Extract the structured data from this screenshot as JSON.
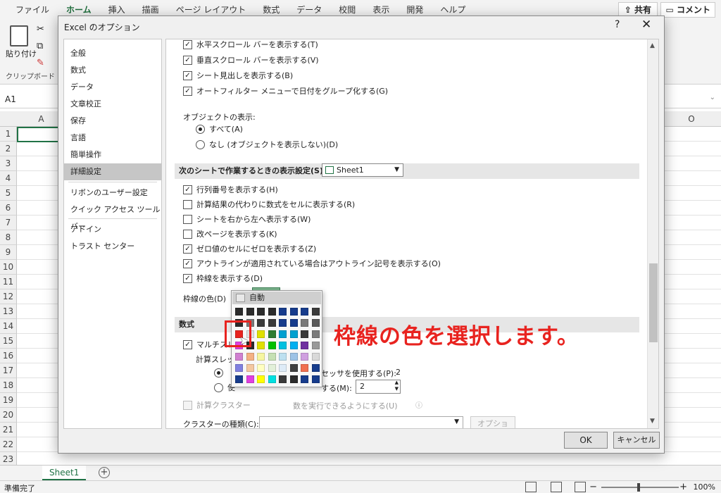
{
  "ribbon": {
    "tabs": [
      "ファイル",
      "ホーム",
      "挿入",
      "描画",
      "ページ レイアウト",
      "数式",
      "データ",
      "校閲",
      "表示",
      "開発",
      "ヘルプ"
    ],
    "active_tab": "ホーム",
    "share_label": "共有",
    "comment_label": "コメント",
    "paste_label": "貼り付け",
    "clipboard_label": "クリップボード"
  },
  "formula_bar": {
    "name_box": "A1"
  },
  "grid": {
    "columns": [
      "A",
      "O"
    ],
    "rows": [
      "1",
      "2",
      "3",
      "4",
      "5",
      "6",
      "7",
      "8",
      "9",
      "10",
      "11",
      "12",
      "13",
      "14",
      "15",
      "16",
      "17",
      "18",
      "19",
      "20",
      "21",
      "22",
      "23"
    ]
  },
  "sheet_tabs": {
    "active": "Sheet1"
  },
  "status": {
    "ready": "準備完了",
    "zoom": "100%"
  },
  "dialog": {
    "title": "Excel のオプション",
    "help": "?",
    "close": "✕",
    "nav": [
      "全般",
      "数式",
      "データ",
      "文章校正",
      "保存",
      "言語",
      "簡単操作",
      "詳細設定",
      "リボンのユーザー設定",
      "クイック アクセス ツール バー",
      "アドイン",
      "トラスト センター"
    ],
    "active_nav": "詳細設定",
    "options_top": [
      {
        "label": "水平スクロール バーを表示する(T)",
        "checked": true
      },
      {
        "label": "垂直スクロール バーを表示する(V)",
        "checked": true
      },
      {
        "label": "シート見出しを表示する(B)",
        "checked": true
      },
      {
        "label": "オートフィルター メニューで日付をグループ化する(G)",
        "checked": true
      }
    ],
    "objects_label": "オブジェクトの表示:",
    "objects_radio": [
      {
        "label": "すべて(A)",
        "selected": true
      },
      {
        "label": "なし (オブジェクトを表示しない)(D)",
        "selected": false
      }
    ],
    "sheet_section_label": "次のシートで作業するときの表示設定(S):",
    "sheet_select": "Sheet1",
    "options_sheet": [
      {
        "label": "行列番号を表示する(H)",
        "checked": true
      },
      {
        "label": "計算結果の代わりに数式をセルに表示する(R)",
        "checked": false
      },
      {
        "label": "シートを右から左へ表示する(W)",
        "checked": false
      },
      {
        "label": "改ページを表示する(K)",
        "checked": false
      },
      {
        "label": "ゼロ値のセルにゼロを表示する(Z)",
        "checked": true
      },
      {
        "label": "アウトラインが適用されている場合はアウトライン記号を表示する(O)",
        "checked": true
      },
      {
        "label": "枠線を表示する(D)",
        "checked": true
      }
    ],
    "gridline_color_label": "枠線の色(D)",
    "formula_section": "数式",
    "multithread_label": "マルチスレ",
    "calc_threads_label": "計算スレッ",
    "radio_all_suffix": "セッサを使用する(P):",
    "radio_all_value": "2",
    "radio_manual_prefix": "使",
    "radio_manual_suffix": "する(M):",
    "manual_value": "2",
    "cluster_option_prefix": "計算クラスター",
    "cluster_option_suffix": "数を実行できるようにする(U)",
    "cluster_type_label": "クラスターの種類(C):",
    "options_button": "オプション...",
    "ok": "OK",
    "cancel": "キャンセル"
  },
  "palette": {
    "auto_label": "自動",
    "colors": [
      [
        "#2b2b2b",
        "#2b2b2b",
        "#2b2b2b",
        "#2b2b2b",
        "#173c8c",
        "#173c8c",
        "#173c8c",
        "#3b3b3b"
      ],
      [
        "#2b2b2b",
        "#7a7a7a",
        "#3a3a3a",
        "#3a3a3a",
        "#173c8c",
        "#173c8c",
        "#7a7a7a",
        "#595959"
      ],
      [
        "#e8231f",
        "#e0e0e0",
        "#e0e000",
        "#2e7d32",
        "#00a0d0",
        "#00a0d0",
        "#3a3a3a",
        "#7a7a7a"
      ],
      [
        "#e040e0",
        "#2b2b2b",
        "#e0e000",
        "#00c000",
        "#00c0e0",
        "#00b0f0",
        "#7030a0",
        "#999999"
      ],
      [
        "#d080d0",
        "#f4b183",
        "#f6f6a0",
        "#c5e0b4",
        "#bde0f0",
        "#9dc3e6",
        "#d0a0e0",
        "#d9d9d9"
      ],
      [
        "#8080e0",
        "#f4c7a0",
        "#ffffc0",
        "#e2f0d9",
        "#deebf7",
        "#404040",
        "#f07050",
        "#173c8c"
      ],
      [
        "#173c8c",
        "#e040e0",
        "#ffff00",
        "#00e0e0",
        "#3a3a3a",
        "#2b2b2b",
        "#173c8c",
        "#173c8c"
      ]
    ]
  },
  "annotation": "枠線の色を選択します。"
}
